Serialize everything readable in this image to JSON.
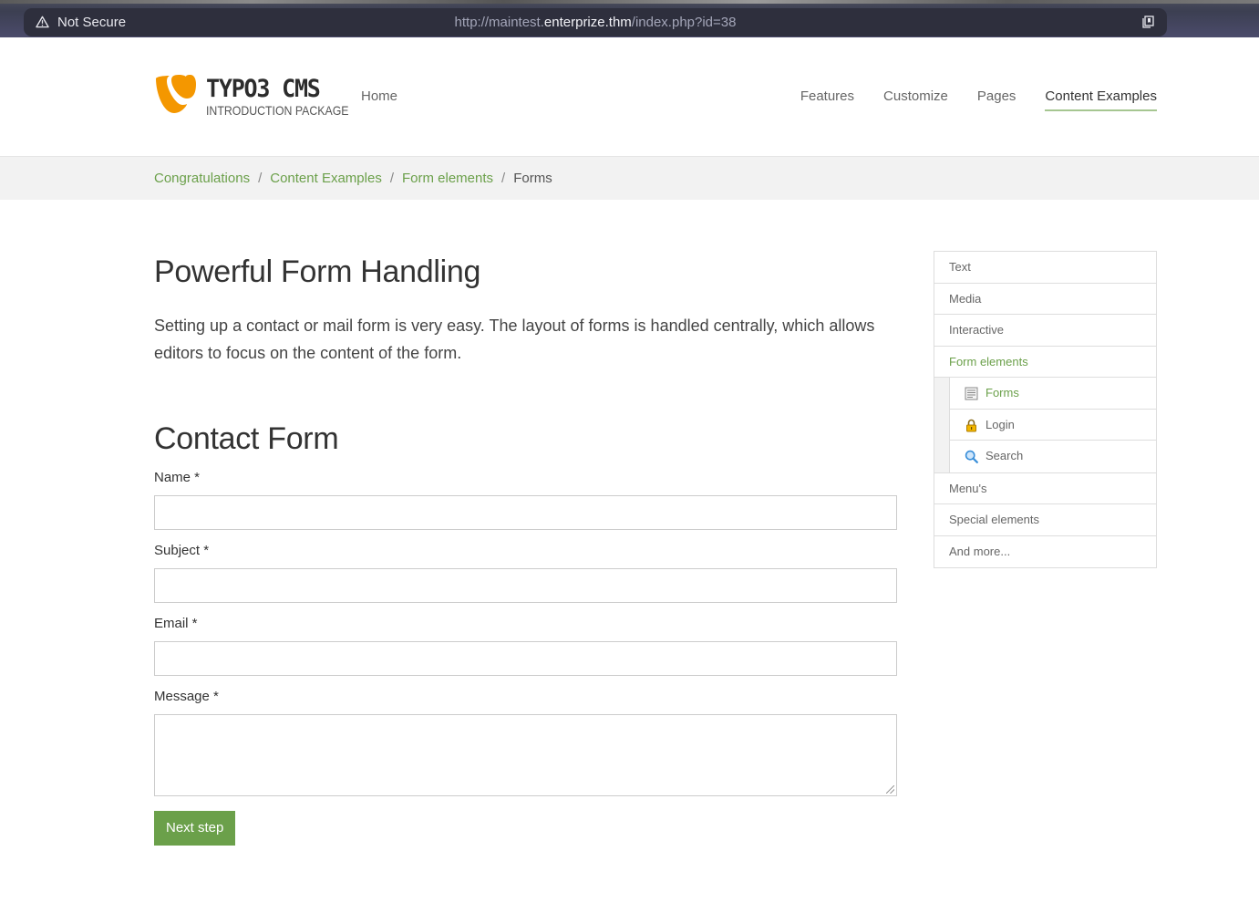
{
  "browser": {
    "security_label": "Not Secure",
    "url_prefix": "http://maintest.",
    "url_host": "enterprize.thm",
    "url_path": "/index.php?id=38",
    "icons": [
      "warning-icon",
      "bookmark-icon"
    ]
  },
  "header": {
    "logo_title": "TYPO3 CMS",
    "logo_subtitle": "INTRODUCTION PACKAGE",
    "nav_home": "Home",
    "nav_items": [
      {
        "label": "Features"
      },
      {
        "label": "Customize"
      },
      {
        "label": "Pages"
      },
      {
        "label": "Content Examples",
        "active": true
      }
    ]
  },
  "breadcrumb": {
    "items": [
      "Congratulations",
      "Content Examples",
      "Form elements"
    ],
    "separator": "/",
    "current": "Forms"
  },
  "main": {
    "title": "Powerful Form Handling",
    "lead": "Setting up a contact or mail form is very easy. The layout of forms is handled centrally, which allows editors to focus on the content of the form.",
    "form_title": "Contact Form",
    "fields": {
      "name_label": "Name *",
      "subject_label": "Subject *",
      "email_label": "Email *",
      "message_label": "Message *"
    },
    "submit_label": "Next step"
  },
  "sidebar": {
    "items_top": [
      "Text",
      "Media",
      "Interactive",
      "Form elements"
    ],
    "sub_items": [
      {
        "label": "Forms",
        "icon": "form-icon",
        "active": true
      },
      {
        "label": "Login",
        "icon": "lock-icon"
      },
      {
        "label": "Search",
        "icon": "magnifier-icon"
      }
    ],
    "items_bottom": [
      "Menu's",
      "Special elements",
      "And more..."
    ]
  },
  "colors": {
    "accent_green": "#6ba04a",
    "logo_orange": "#f49700",
    "nav_underline": "#a6c691"
  }
}
